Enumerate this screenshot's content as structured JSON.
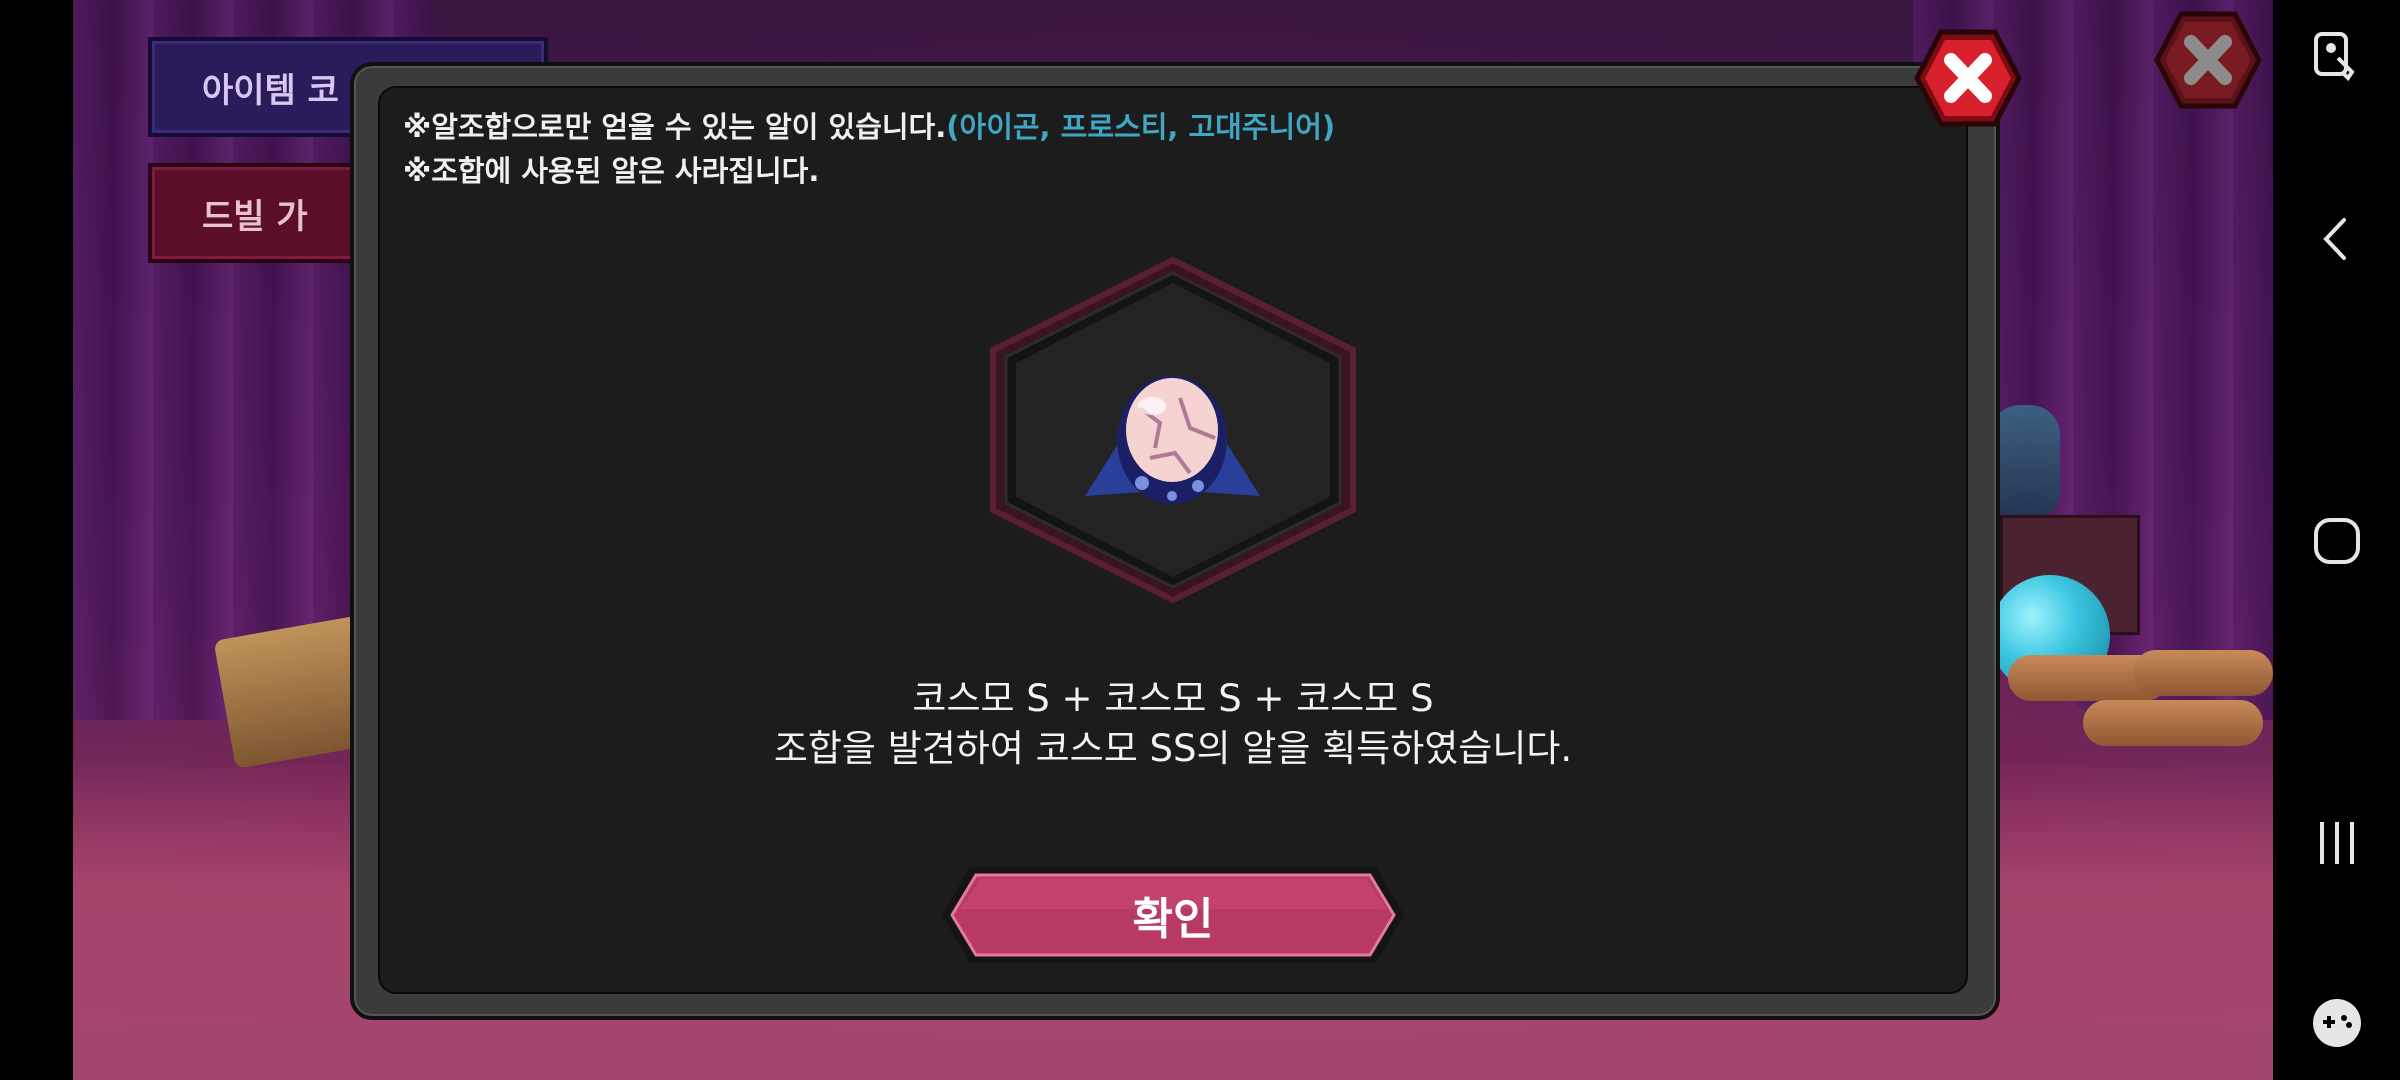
{
  "background": {
    "side_buttons": [
      {
        "label": "아이템 코",
        "color": "#2a1c5a"
      },
      {
        "label": "드빌 가",
        "color": "#5a0e2a"
      }
    ]
  },
  "dialog": {
    "notice_line1": "※알조합으로만 얻을 수 있는 알이 있습니다.",
    "notice_line1_highlight": "(아이곤, 프로스티, 고대주니어)",
    "notice_line2": "※조합에 사용된 알은 사라집니다.",
    "result_line1": "코스모 S + 코스모 S + 코스모 S",
    "result_line2": "조합을 발견하여 코스모 SS의 알을 획득하였습니다.",
    "confirm_label": "확인",
    "highlight_color": "#3fa7c4",
    "confirm_color": "#b83a64",
    "close_color": "#d8202c"
  },
  "icons": {
    "dialog_close": "close-icon",
    "background_close": "close-icon",
    "egg": "cosmo-egg-icon",
    "nav": [
      "accessibility-icon",
      "back-icon",
      "home-icon",
      "recent-apps-icon",
      "game-controller-icon"
    ]
  }
}
